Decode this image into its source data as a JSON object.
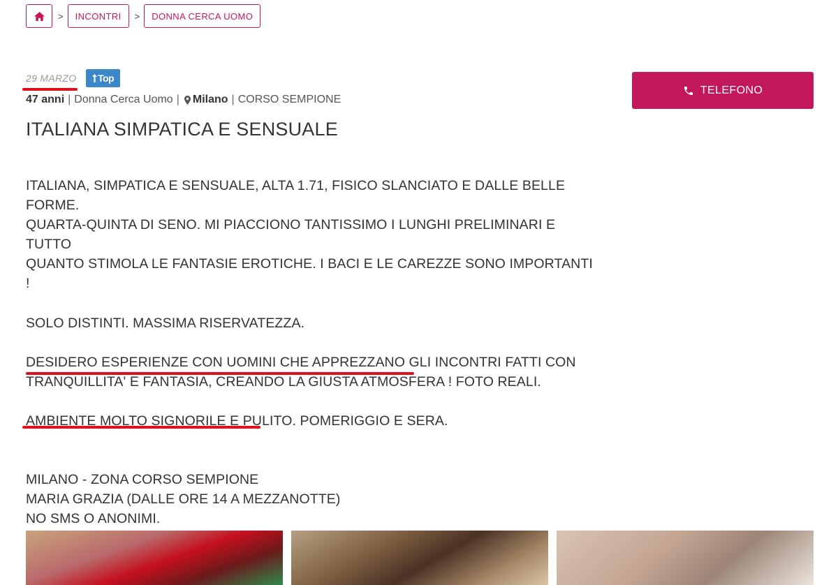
{
  "breadcrumb": {
    "home_icon": "home-icon",
    "separator": ">",
    "items": [
      "INCONTRI",
      "DONNA CERCA UOMO"
    ]
  },
  "listing": {
    "date": "29 MARZO",
    "badge": "Top",
    "age": "47 anni",
    "category": "Donna Cerca Uomo",
    "city": "Milano",
    "zone": "CORSO SEMPIONE",
    "separator": "|",
    "title": "ITALIANA SIMPATICA E SENSUALE",
    "paragraphs": [
      "ITALIANA, SIMPATICA E SENSUALE, ALTA 1.71, FISICO SLANCIATO E DALLE BELLE FORME.\nQUARTA-QUINTA DI SENO. MI PIACCIONO TANTISSIMO I LUNGHI PRELIMINARI E TUTTO\nQUANTO STIMOLA LE FANTASIE EROTICHE. I BACI E LE CAREZZE SONO IMPORTANTI !",
      "SOLO DISTINTI. MASSIMA RISERVATEZZA.",
      "DESIDERO ESPERIENZE CON UOMINI CHE APPREZZANO GLI INCONTRI FATTI CON\nTRANQUILLITA' E FANTASIA, CREANDO LA GIUSTA ATMOSFERA ! FOTO REALI.",
      "AMBIENTE MOLTO SIGNORILE E PULITO. POMERIGGIO E SERA.",
      "MILANO - ZONA CORSO SEMPIONE\nMARIA GRAZIA (DALLE ORE 14 A MEZZANOTTE)\nNO SMS O ANONIMI."
    ]
  },
  "contact": {
    "phone_label": "TELEFONO",
    "phone_icon": "phone-icon"
  },
  "colors": {
    "accent": "#c2185b",
    "badge": "#3c87c9",
    "annotation": "#e01020"
  }
}
